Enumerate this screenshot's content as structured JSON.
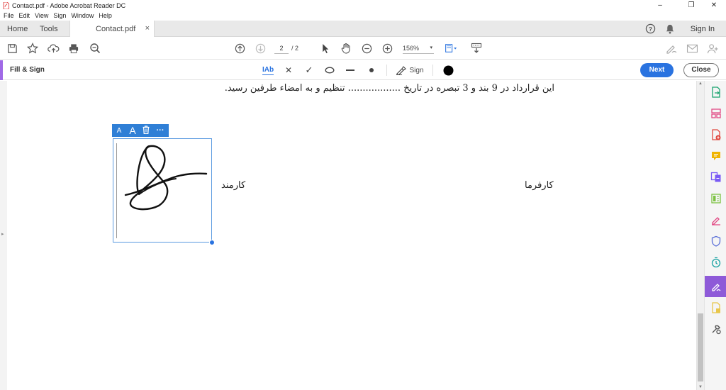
{
  "window": {
    "title": "Contact.pdf - Adobe Acrobat Reader DC",
    "controls": {
      "minimize": "–",
      "maximize": "❐",
      "close": "✕"
    }
  },
  "menu": [
    "File",
    "Edit",
    "View",
    "Sign",
    "Window",
    "Help"
  ],
  "tabs": {
    "home": "Home",
    "tools": "Tools",
    "document": "Contact.pdf",
    "close_tab": "×",
    "sign_in": "Sign In"
  },
  "toolbar": {
    "current_page": "2",
    "total_pages": "/ 2",
    "zoom": "156%",
    "zoom_caret": "▾"
  },
  "fill_sign": {
    "label": "Fill & Sign",
    "text_tool": "IAb",
    "cross_tool": "✕",
    "check_tool": "✓",
    "sign_label": "Sign",
    "color": "#000000",
    "next_button": "Next",
    "close_button": "Close"
  },
  "document": {
    "line1": "این قرارداد در 9 بند و 3 تبصره در تاریخ .................. تنظیم و به امضاء طرفین رسید.",
    "party_employer": "کارفرما",
    "party_employee": "کارمند"
  },
  "signature_toolbar": {
    "smaller": "A",
    "larger": "A",
    "more": "···"
  },
  "scroll": {
    "up": "▲",
    "down": "▼"
  },
  "left_panel_toggle": "▸",
  "colors": {
    "accent_purple": "#a069e6",
    "rail_active": "#8e5ad8",
    "primary_blue": "#2a73e0",
    "signature_toolbar": "#2f7fd6"
  },
  "right_rail_icons": [
    "export-pdf-icon",
    "organize-pages-icon",
    "create-pdf-icon",
    "comment-icon",
    "combine-files-icon",
    "edit-pdf-icon",
    "fill-sign-pen-icon",
    "protect-icon",
    "send-for-review-icon",
    "fill-sign-active-icon",
    "stamp-icon",
    "more-tools-icon"
  ]
}
